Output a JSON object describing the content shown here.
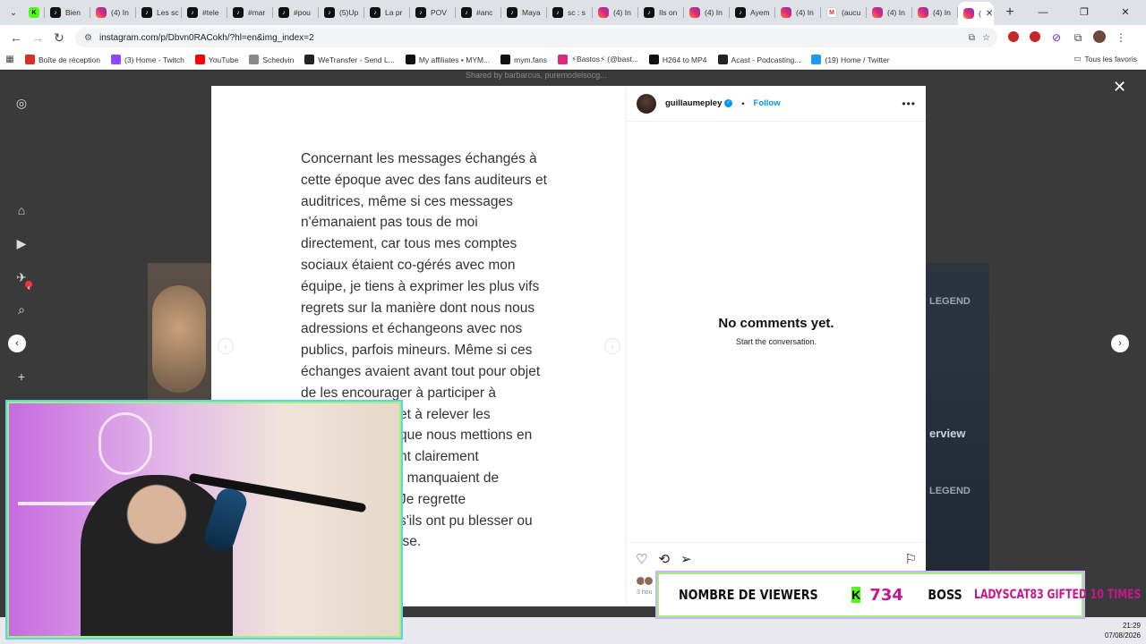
{
  "tabs": [
    {
      "label": "",
      "icon": "kick-icon"
    },
    {
      "label": "Bien",
      "icon": "tiktok-icon"
    },
    {
      "label": "(4) In",
      "icon": "instagram-icon"
    },
    {
      "label": "Les sc",
      "icon": "tiktok-icon"
    },
    {
      "label": "#tele",
      "icon": "tiktok-icon"
    },
    {
      "label": "#mar",
      "icon": "tiktok-icon"
    },
    {
      "label": "#pou",
      "icon": "tiktok-icon"
    },
    {
      "label": "(5)Up",
      "icon": "tiktok-icon"
    },
    {
      "label": "La pr",
      "icon": "tiktok-icon"
    },
    {
      "label": "POV",
      "icon": "tiktok-icon"
    },
    {
      "label": "#anc",
      "icon": "tiktok-icon"
    },
    {
      "label": "Maya",
      "icon": "tiktok-icon"
    },
    {
      "label": "sc : s",
      "icon": "tiktok-icon"
    },
    {
      "label": "(4) In",
      "icon": "instagram-icon"
    },
    {
      "label": "Ils on",
      "icon": "tiktok-icon"
    },
    {
      "label": "(4) In",
      "icon": "instagram-icon"
    },
    {
      "label": "Ayem",
      "icon": "tiktok-icon"
    },
    {
      "label": "(4) In",
      "icon": "instagram-icon"
    },
    {
      "label": "(aucu",
      "icon": "gmail-icon"
    },
    {
      "label": "(4) In",
      "icon": "instagram-icon"
    },
    {
      "label": "(4) In",
      "icon": "instagram-icon"
    }
  ],
  "active_tab": {
    "label": "(",
    "icon": "instagram-icon"
  },
  "url": "instagram.com/p/Dbvn0RACokh/?hl=en&img_index=2",
  "bookmarks": [
    {
      "label": "Boîte de réception",
      "color": "#d93025"
    },
    {
      "label": "(3) Home - Twitch",
      "color": "#9146ff"
    },
    {
      "label": "YouTube",
      "color": "#ff0000"
    },
    {
      "label": "Schedvin",
      "color": "#888888"
    },
    {
      "label": "WeTransfer - Send L...",
      "color": "#222222"
    },
    {
      "label": "My affiliates • MYM...",
      "color": "#111111"
    },
    {
      "label": "mym.fans",
      "color": "#111111"
    },
    {
      "label": "⚡Bastos⚡ (@bast...",
      "color": "#dd2a7b"
    },
    {
      "label": "H264 to MP4",
      "color": "#111111"
    },
    {
      "label": "Acast - Podcasting...",
      "color": "#222222"
    },
    {
      "label": "(19) Home / Twitter",
      "color": "#1d9bf0"
    }
  ],
  "bookmarks_right": "Tous les favoris",
  "post": {
    "username": "guillaumepley",
    "follow_label": "Follow",
    "body": "Concernant les messages échangés à cette époque avec des fans auditeurs et auditrices, même si ces messages n'émanaient pas tous de moi directement, car tous mes comptes sociaux étaient co-gérés avec mon équipe, je tiens à exprimer les plus vifs regrets sur la manière dont nous nous adressions et échangeons avec nos publics, parfois mineurs. Même si ces échanges avaient avant tout pour objet de les encourager à participer à",
    "body_tail": [
      "et à relever les",
      "que nous mettions en",
      "nt clairement",
      "t manquaient de",
      "Je regrette",
      "s'ils ont pu blesser ou",
      "ise."
    ],
    "empty_title": "No comments yet.",
    "empty_subtitle": "Start the conversation.",
    "time_ago": "3 hou"
  },
  "background": {
    "legend_label": "LEGEND",
    "interview_label": "erview",
    "top_strip": "Shared by barbarcus, puremodelsocg..."
  },
  "stream": {
    "viewers_label": "NOMBRE DE VIEWERS",
    "viewers_count": "734",
    "boss_label": "BOSS",
    "gift_text": "LADYSCAT83 GIFTED 10 TIMES",
    "accent_green": "#53fc18",
    "accent_magenta": "#c2178f"
  },
  "clock": {
    "time": "21:29",
    "date": "07/08/2026"
  },
  "notification_count": "4"
}
